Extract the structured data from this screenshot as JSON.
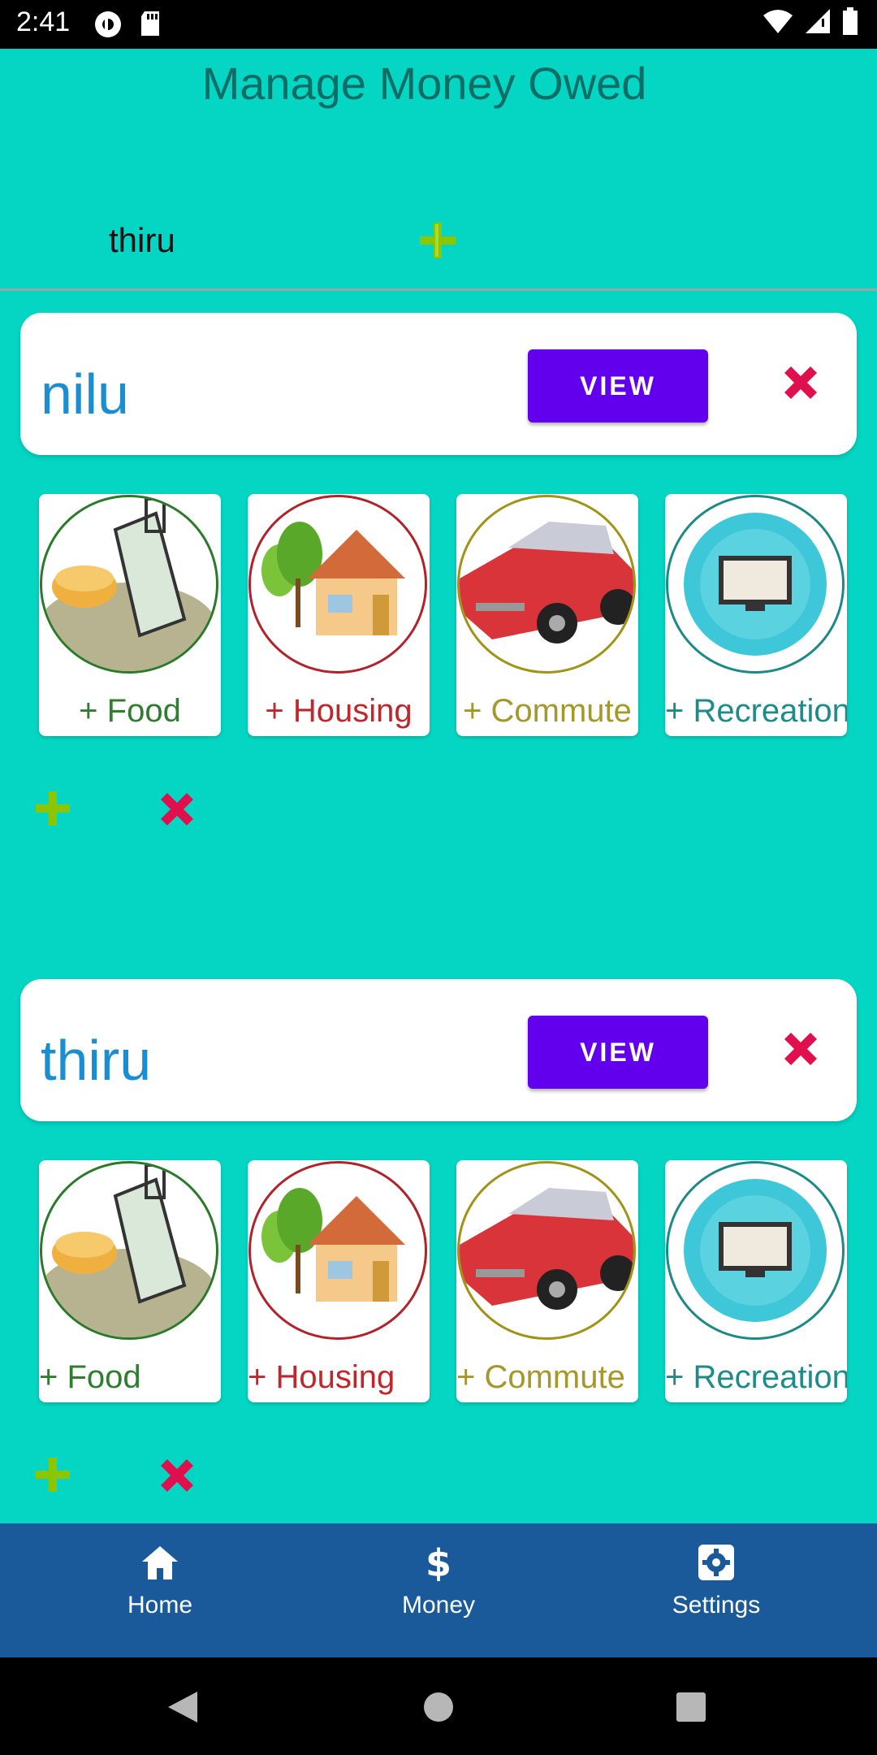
{
  "status_bar": {
    "time": "2:41"
  },
  "page": {
    "title": "Manage Money Owed"
  },
  "add_person": {
    "name": "thiru"
  },
  "people": [
    {
      "name": "nilu",
      "view_label": "VIEW",
      "categories": [
        {
          "label": "+ Food"
        },
        {
          "label": "+ Housing"
        },
        {
          "label": "+ Commute"
        },
        {
          "label": "+ Recreation"
        }
      ]
    },
    {
      "name": "thiru",
      "view_label": "VIEW",
      "categories": [
        {
          "label": "+ Food"
        },
        {
          "label": "+ Housing"
        },
        {
          "label": "+ Commute"
        },
        {
          "label": "+ Recreation"
        }
      ]
    }
  ],
  "bottom_nav": {
    "items": [
      {
        "label": "Home",
        "icon": "home-icon"
      },
      {
        "label": "Money",
        "icon": "dollar-icon"
      },
      {
        "label": "Settings",
        "icon": "gear-icon"
      }
    ]
  },
  "colors": {
    "background": "#05d6c4",
    "accent": "#6200ee",
    "nav": "#1a5a9a",
    "name_text": "#1a8ed1",
    "delete": "#e0104f",
    "add": "#8bc600"
  }
}
